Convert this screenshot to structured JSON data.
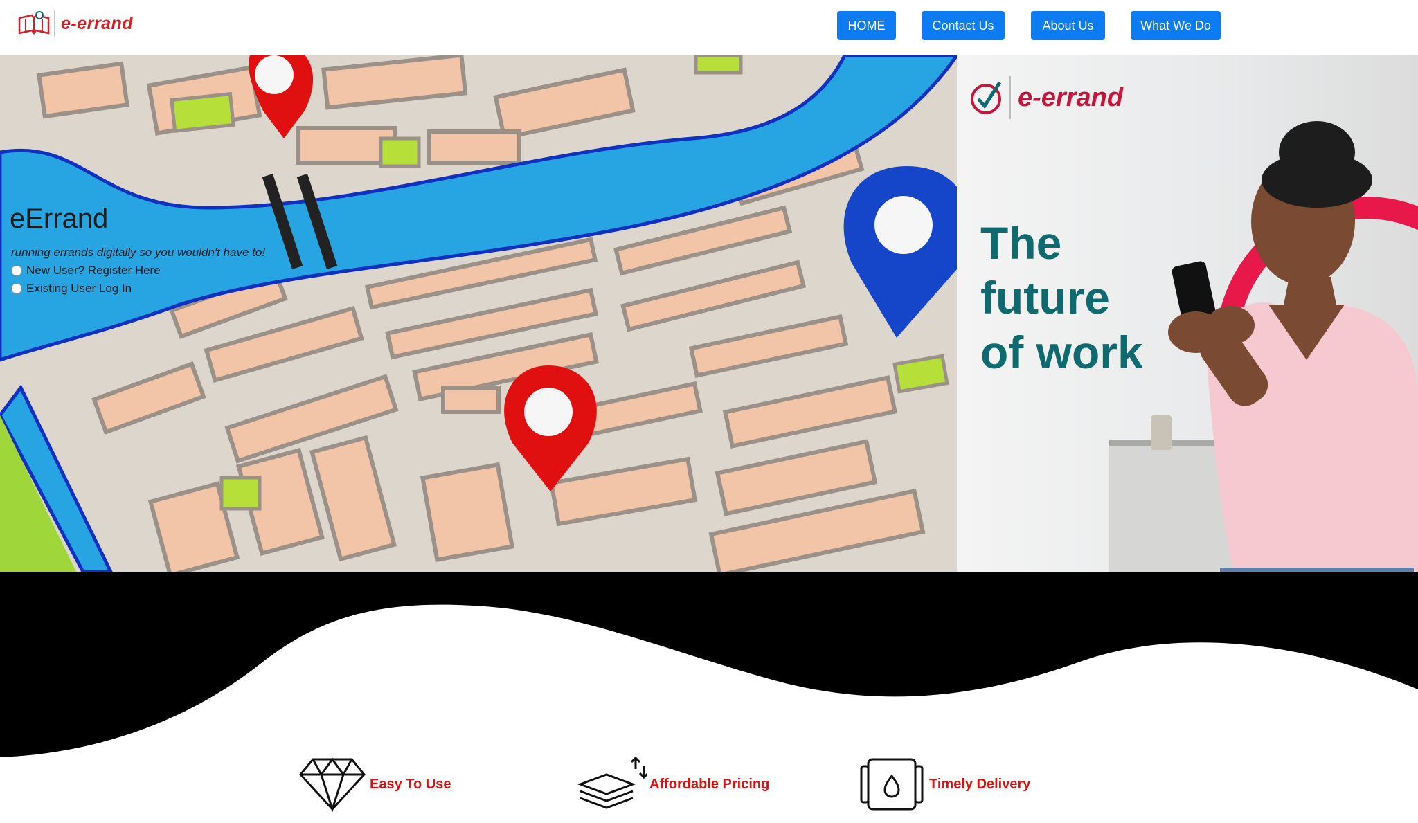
{
  "brand": {
    "name": "e-errand",
    "accent": "#e4134f"
  },
  "nav": {
    "items": [
      {
        "label": "HOME"
      },
      {
        "label": "Contact Us"
      },
      {
        "label": "About Us"
      },
      {
        "label": "What We Do"
      }
    ],
    "button_color": "#0d7bf2"
  },
  "hero": {
    "title": "eErrand",
    "tagline": "running errands digitally so you wouldn't have to!",
    "options": [
      {
        "label": "New User? Register Here"
      },
      {
        "label": "Existing User Log In"
      }
    ]
  },
  "promo": {
    "brand": "e-errand",
    "headline": [
      "The",
      "future",
      "of work"
    ],
    "headline_color": "#0e6a6e"
  },
  "features": [
    {
      "label": "Easy To Use",
      "icon": "diamond-icon"
    },
    {
      "label": "Affordable Pricing",
      "icon": "stack-arrows-icon"
    },
    {
      "label": "Timely Delivery",
      "icon": "droplet-box-icon"
    }
  ]
}
